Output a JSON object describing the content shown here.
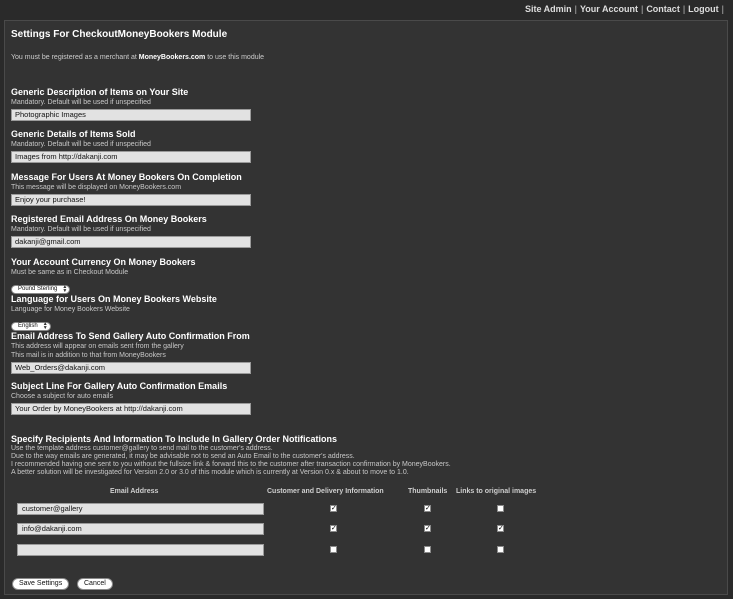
{
  "nav": {
    "items": [
      "Site Admin",
      "Your Account",
      "Contact",
      "Logout"
    ],
    "trailing_sep": "|"
  },
  "page": {
    "title": "Settings For CheckoutMoneyBookers Module",
    "intro_pre": "You must be registered as a merchant at ",
    "intro_link": "MoneyBookers.com",
    "intro_post": " to use this module"
  },
  "fields": {
    "desc": {
      "label": "Generic Description of Items on Your Site",
      "help": "Mandatory. Default will be used if unspecified",
      "value": "Photographic Images"
    },
    "details": {
      "label": "Generic Details of Items Sold",
      "help": "Mandatory. Default will be used if unspecified",
      "value": "Images from http://dakanji.com"
    },
    "message": {
      "label": "Message For Users At Money Bookers On Completion",
      "help": "This message will be displayed on MoneyBookers.com",
      "value": "Enjoy your purchase!"
    },
    "email": {
      "label": "Registered Email Address On Money Bookers",
      "help": "Mandatory. Default will be used if unspecified",
      "value": "dakanji@gmail.com"
    },
    "currency": {
      "label": "Your Account Currency On Money Bookers",
      "help": "Must be same as in Checkout Module",
      "selected": "Pound Sterling"
    },
    "language": {
      "label": "Language for Users On Money Bookers Website",
      "help": "Language for Money Bookers Website",
      "selected": "English"
    },
    "from": {
      "label": "Email Address To Send Gallery Auto Confirmation From",
      "help1": "This address will appear on emails sent from the gallery",
      "help2": "This mail is in addition to that from MoneyBookers",
      "value": "Web_Orders@dakanji.com"
    },
    "subject": {
      "label": "Subject Line For Gallery Auto Confirmation Emails",
      "help": "Choose a subject for auto emails",
      "value": "Your Order by MoneyBookers at http://dakanji.com"
    }
  },
  "recipients": {
    "title": "Specify Recipients And Information To Include In Gallery Order Notifications",
    "help": [
      "Use the template address customer@gallery to send mail to the customer's address.",
      "Due to the way emails are generated, it may be advisable not to send an Auto Email to the customer's address.",
      "I recommended having one sent to you without the fullsize link & forward this to the customer after transaction confirmation by MoneyBookers.",
      "A better solution will be investigated for Version 2.0 or 3.0 of this module which is currently at Version 0.x & about to move to 1.0."
    ],
    "columns": [
      "Email Address",
      "Customer and Delivery Information",
      "Thumbnails",
      "Links to original images"
    ],
    "rows": [
      {
        "email": "customer@gallery",
        "info": true,
        "thumbs": true,
        "links": false
      },
      {
        "email": "info@dakanji.com",
        "info": true,
        "thumbs": true,
        "links": true
      },
      {
        "email": "",
        "info": false,
        "thumbs": false,
        "links": false
      }
    ]
  },
  "buttons": {
    "save": "Save Settings",
    "cancel": "Cancel"
  }
}
